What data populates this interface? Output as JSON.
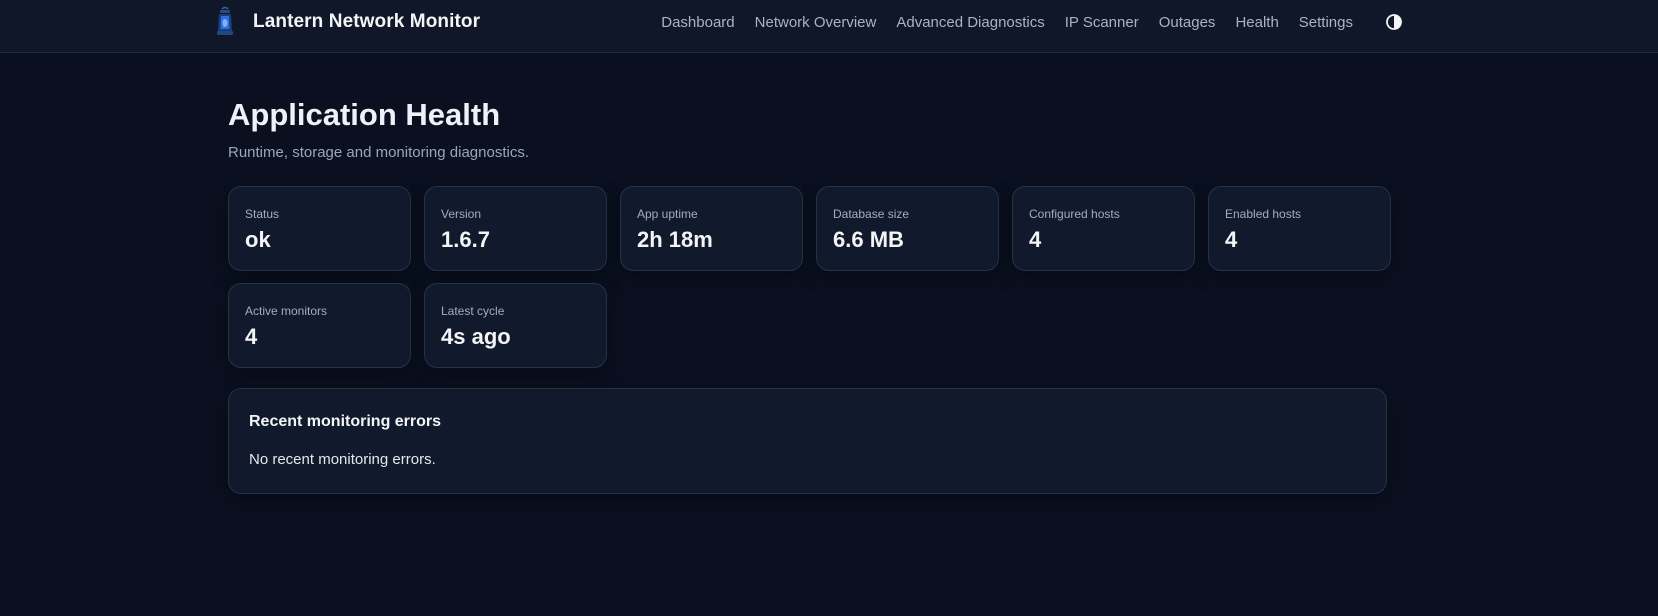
{
  "header": {
    "app_title": "Lantern Network Monitor",
    "logo_icon": "lantern-icon",
    "nav_items": [
      {
        "label": "Dashboard"
      },
      {
        "label": "Network Overview"
      },
      {
        "label": "Advanced Diagnostics"
      },
      {
        "label": "IP Scanner"
      },
      {
        "label": "Outages"
      },
      {
        "label": "Health"
      },
      {
        "label": "Settings"
      }
    ],
    "theme_toggle_icon": "contrast-icon"
  },
  "page": {
    "title": "Application Health",
    "subtitle": "Runtime, storage and monitoring diagnostics."
  },
  "stats": [
    {
      "label": "Status",
      "value": "ok"
    },
    {
      "label": "Version",
      "value": "1.6.7"
    },
    {
      "label": "App uptime",
      "value": "2h 18m"
    },
    {
      "label": "Database size",
      "value": "6.6 MB"
    },
    {
      "label": "Configured hosts",
      "value": "4"
    },
    {
      "label": "Enabled hosts",
      "value": "4"
    },
    {
      "label": "Active monitors",
      "value": "4"
    },
    {
      "label": "Latest cycle",
      "value": "4s ago"
    }
  ],
  "errors_panel": {
    "title": "Recent monitoring errors",
    "empty_text": "No recent monitoring errors."
  },
  "colors": {
    "background": "#0a1020",
    "topbar": "#0f1728",
    "card": "#111a2c",
    "border": "#263247",
    "nav_text": "#a8b3c7",
    "accent_logo": "#2f6fe0"
  }
}
